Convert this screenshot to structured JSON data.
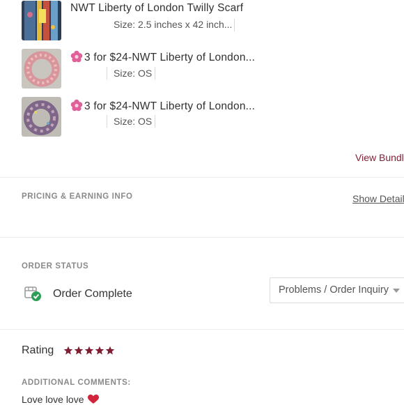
{
  "items": [
    {
      "title": "NWT Liberty of London Twilly Scarf",
      "size": "Size: 2.5 inches x 42 inch...",
      "promo": false
    },
    {
      "title": "3 for $24-NWT Liberty of London...",
      "size": "Size: OS",
      "promo": true
    },
    {
      "title": "3 for $24-NWT Liberty of London...",
      "size": "Size: OS",
      "promo": true
    }
  ],
  "view_bundle_label": "View Bundle",
  "pricing": {
    "section_label": "PRICING & EARNING INFO",
    "show_details_label": "Show Details"
  },
  "order_status": {
    "section_label": "ORDER STATUS",
    "status_text": "Order Complete",
    "dropdown_value": "Problems / Order Inquiry"
  },
  "rating": {
    "label": "Rating",
    "stars": 5
  },
  "comments": {
    "section_label": "ADDITIONAL COMMENTS:",
    "text": "Love love love"
  },
  "colors": {
    "accent": "#7f1d32",
    "promo_flower": "#e0609a",
    "check": "#2e9e57"
  }
}
